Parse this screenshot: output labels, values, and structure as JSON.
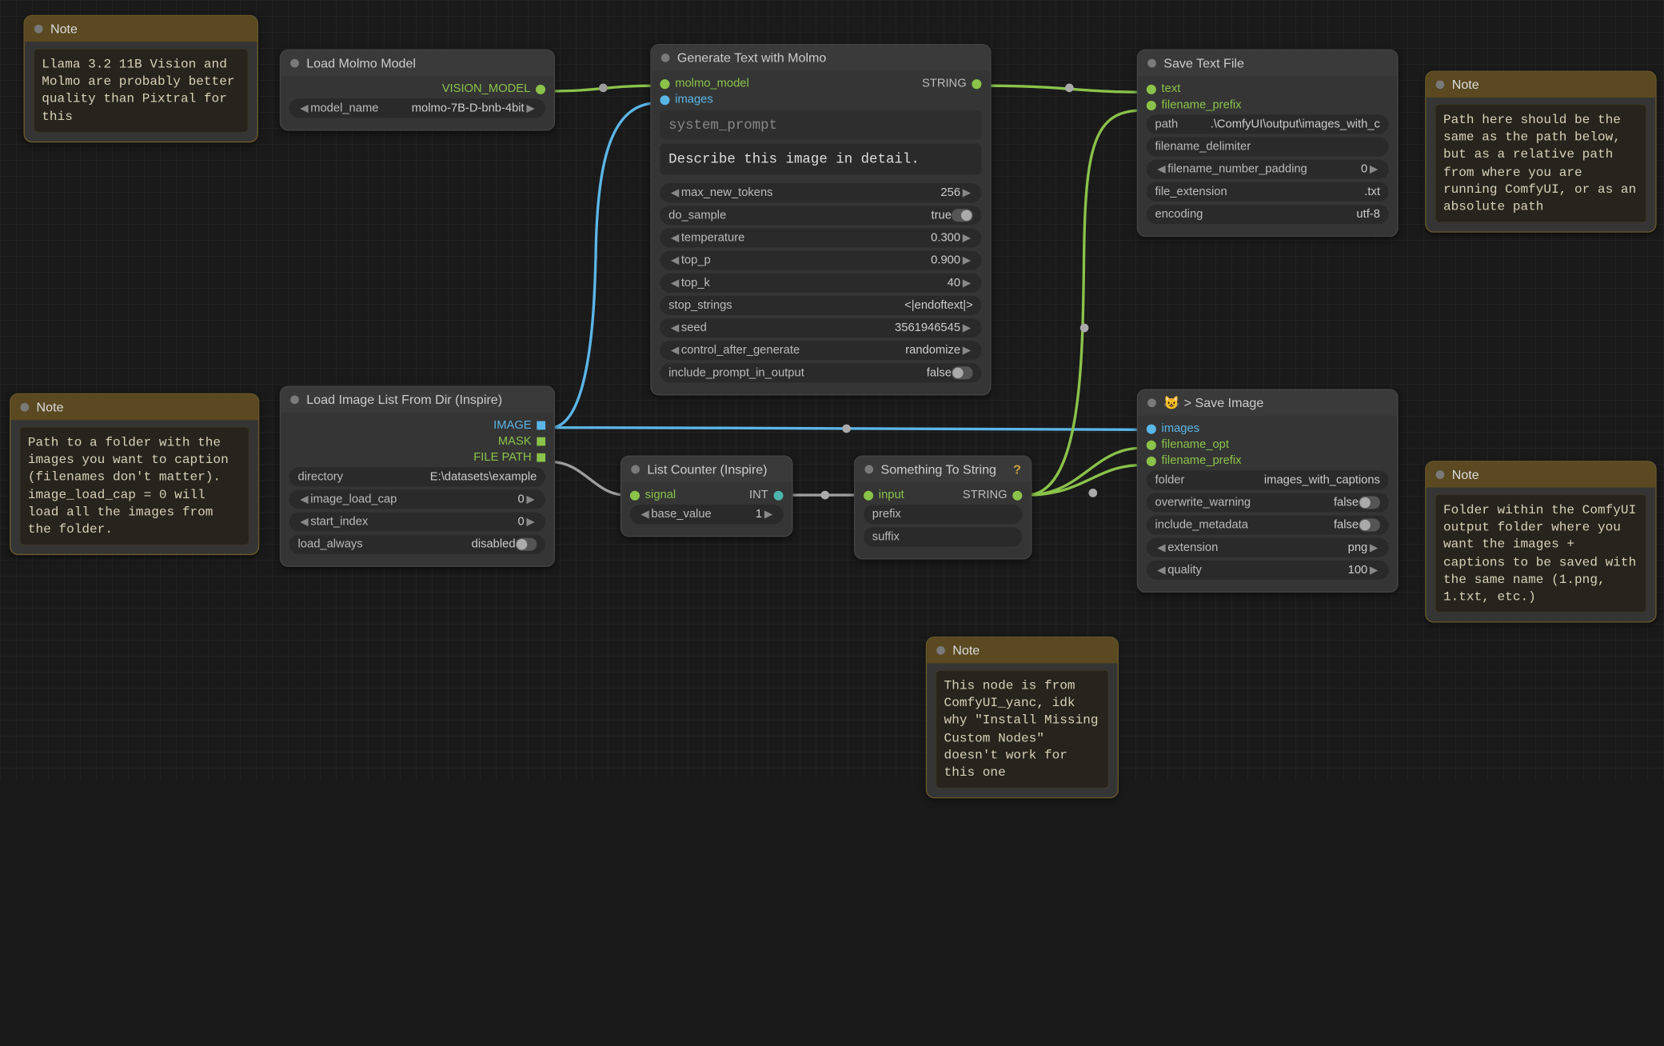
{
  "notes": {
    "n1": {
      "title": "Note",
      "text": "Llama 3.2 11B Vision and Molmo are probably better quality than Pixtral for this"
    },
    "n2": {
      "title": "Note",
      "text": "Path to a folder with the images you want to caption (filenames don't matter). image_load_cap = 0 will load all the images from the folder."
    },
    "n3": {
      "title": "Note",
      "text": "This node is from ComfyUI_yanc, idk why \"Install Missing Custom Nodes\" doesn't work for this one"
    },
    "n4": {
      "title": "Note",
      "text": "Path here should be the same as the path below, but as a relative path from where you are running ComfyUI, or as an absolute path"
    },
    "n5": {
      "title": "Note",
      "text": "Folder within the ComfyUI output folder where you want the images + captions to be saved with the same name (1.png, 1.txt, etc.)"
    }
  },
  "loadMolmo": {
    "title": "Load Molmo Model",
    "out": "VISION_MODEL",
    "model_name": {
      "label": "model_name",
      "value": "molmo-7B-D-bnb-4bit"
    }
  },
  "loadImage": {
    "title": "Load Image List From Dir (Inspire)",
    "outs": {
      "image": "IMAGE",
      "mask": "MASK",
      "filepath": "FILE PATH"
    },
    "directory": {
      "label": "directory",
      "value": "E:\\datasets\\example"
    },
    "image_load_cap": {
      "label": "image_load_cap",
      "value": "0"
    },
    "start_index": {
      "label": "start_index",
      "value": "0"
    },
    "load_always": {
      "label": "load_always",
      "value": "disabled"
    }
  },
  "genText": {
    "title": "Generate Text with Molmo",
    "ins": {
      "model": "molmo_model",
      "images": "images"
    },
    "out": "STRING",
    "system_prompt_label": "system_prompt",
    "system_prompt": "Describe this image in detail.",
    "max_new_tokens": {
      "label": "max_new_tokens",
      "value": "256"
    },
    "do_sample": {
      "label": "do_sample",
      "value": "true"
    },
    "temperature": {
      "label": "temperature",
      "value": "0.300"
    },
    "top_p": {
      "label": "top_p",
      "value": "0.900"
    },
    "top_k": {
      "label": "top_k",
      "value": "40"
    },
    "stop_strings": {
      "label": "stop_strings",
      "value": "<|endoftext|>"
    },
    "seed": {
      "label": "seed",
      "value": "3561946545"
    },
    "control_after_generate": {
      "label": "control_after_generate",
      "value": "randomize"
    },
    "include_prompt": {
      "label": "include_prompt_in_output",
      "value": "false"
    }
  },
  "listCounter": {
    "title": "List Counter (Inspire)",
    "in": "signal",
    "out": "INT",
    "base_value": {
      "label": "base_value",
      "value": "1"
    }
  },
  "toString": {
    "title": "Something To String",
    "in": "input",
    "out": "STRING",
    "prefix": {
      "label": "prefix"
    },
    "suffix": {
      "label": "suffix"
    }
  },
  "saveText": {
    "title": "Save Text File",
    "ins": {
      "text": "text",
      "prefix": "filename_prefix"
    },
    "path": {
      "label": "path",
      "value": ".\\ComfyUI\\output\\images_with_c"
    },
    "delimiter": {
      "label": "filename_delimiter"
    },
    "padding": {
      "label": "filename_number_padding",
      "value": "0"
    },
    "ext": {
      "label": "file_extension",
      "value": ".txt"
    },
    "encoding": {
      "label": "encoding",
      "value": "utf-8"
    }
  },
  "saveImage": {
    "title": "> Save Image",
    "icon": "😺",
    "ins": {
      "images": "images",
      "filename_opt": "filename_opt",
      "filename_prefix": "filename_prefix"
    },
    "folder": {
      "label": "folder",
      "value": "images_with_captions"
    },
    "overwrite": {
      "label": "overwrite_warning",
      "value": "false"
    },
    "metadata": {
      "label": "include_metadata",
      "value": "false"
    },
    "extension": {
      "label": "extension",
      "value": "png"
    },
    "quality": {
      "label": "quality",
      "value": "100"
    }
  }
}
